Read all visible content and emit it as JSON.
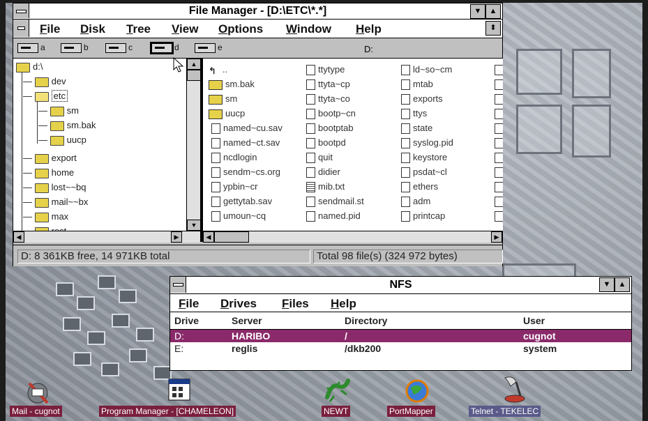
{
  "file_manager": {
    "title": "File Manager - [D:\\ETC\\*.*]",
    "menu": [
      "File",
      "Disk",
      "Tree",
      "View",
      "Options",
      "Window",
      "Help"
    ],
    "drives": [
      "a",
      "b",
      "c",
      "d",
      "e"
    ],
    "current_drive": "D:",
    "tree": {
      "root": "d:\\",
      "items": [
        "dev",
        "etc",
        "sm",
        "sm.bak",
        "uucp",
        "export",
        "home",
        "lost~~bq",
        "mail~~bx",
        "max",
        "rest"
      ]
    },
    "files": {
      "col1": [
        "..",
        "sm.bak",
        "sm",
        "uucp",
        "named~cu.sav",
        "named~ct.sav",
        "ncdlogin",
        "sendm~cs.org",
        "ypbin~cr",
        "gettytab.sav",
        "umoun~cq"
      ],
      "col2": [
        "ttytype",
        "ttyta~cp",
        "ttyta~co",
        "bootp~cn",
        "bootptab",
        "bootpd",
        "quit",
        "didier",
        "mib.txt",
        "sendmail.st",
        "named.pid"
      ],
      "col3": [
        "ld~so~cm",
        "mtab",
        "exports",
        "ttys",
        "state",
        "syslog.pid",
        "keystore",
        "psdat~cl",
        "ethers",
        "adm",
        "printcap"
      ]
    },
    "status_left": "D: 8 361KB free,  14 971KB total",
    "status_right": "Total 98 file(s) (324 972 bytes)"
  },
  "nfs": {
    "title": "NFS",
    "menu": [
      "File",
      "Drives",
      "Files",
      "Help"
    ],
    "headers": {
      "drive": "Drive",
      "server": "Server",
      "directory": "Directory",
      "user": "User"
    },
    "rows": [
      {
        "drive": "D:",
        "server": "HARIBO",
        "directory": "/",
        "user": "cugnot",
        "selected": true
      },
      {
        "drive": "E:",
        "server": "reglis",
        "directory": "/dkb200",
        "user": "system",
        "selected": false
      }
    ]
  },
  "taskbar": [
    {
      "label": "Mail - cugnot",
      "icon": "mail-icon"
    },
    {
      "label": "Program Manager - [CHAMELEON]",
      "icon": "program-manager-icon"
    },
    {
      "label": "NEWT",
      "icon": "newt-lizard-icon"
    },
    {
      "label": "PortMapper",
      "icon": "globe-icon"
    },
    {
      "label": "Telnet - TEKELEC",
      "icon": "telnet-icon"
    }
  ],
  "colors": {
    "selection": "#8a2a6a",
    "taskbar_label": "#7a1f3d",
    "folder": "#e6d24a"
  }
}
